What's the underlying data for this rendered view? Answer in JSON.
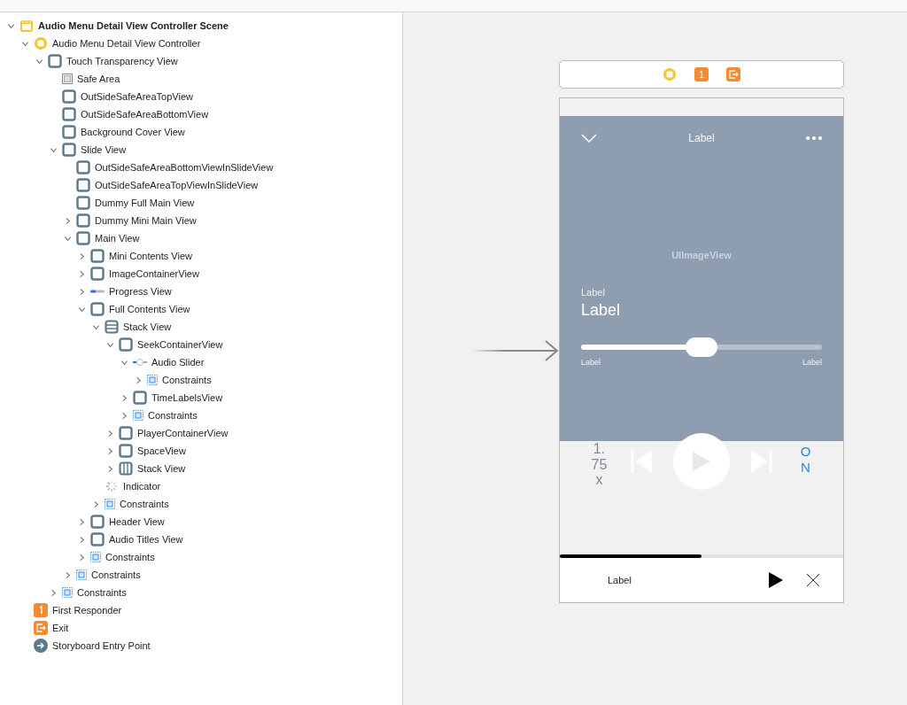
{
  "outline": [
    {
      "label": "Audio Menu Detail View Controller Scene",
      "kind": "scene",
      "expanded": true,
      "children": [
        {
          "label": "Audio Menu Detail View Controller",
          "kind": "controller",
          "expanded": true,
          "children": [
            {
              "label": "Touch Transparency View",
              "kind": "view",
              "expanded": true,
              "children": [
                {
                  "label": "Safe Area",
                  "kind": "safe-area"
                },
                {
                  "label": "OutSideSafeAreaTopView",
                  "kind": "view"
                },
                {
                  "label": "OutSideSafeAreaBottomView",
                  "kind": "view"
                },
                {
                  "label": "Background Cover View",
                  "kind": "view"
                },
                {
                  "label": "Slide View",
                  "kind": "view",
                  "expanded": true,
                  "children": [
                    {
                      "label": "OutSideSafeAreaBottomViewInSlideView",
                      "kind": "view"
                    },
                    {
                      "label": "OutSideSafeAreaTopViewInSlideView",
                      "kind": "view"
                    },
                    {
                      "label": "Dummy Full Main View",
                      "kind": "view"
                    },
                    {
                      "label": "Dummy Mini Main View",
                      "kind": "view",
                      "expanded": false
                    },
                    {
                      "label": "Main View",
                      "kind": "view",
                      "expanded": true,
                      "children": [
                        {
                          "label": "Mini Contents View",
                          "kind": "view",
                          "expanded": false
                        },
                        {
                          "label": "ImageContainerView",
                          "kind": "view",
                          "expanded": false
                        },
                        {
                          "label": "Progress View",
                          "kind": "progress",
                          "expanded": false
                        },
                        {
                          "label": "Full Contents View",
                          "kind": "view",
                          "expanded": true,
                          "children": [
                            {
                              "label": "Stack View",
                              "kind": "vstack",
                              "expanded": true,
                              "children": [
                                {
                                  "label": "SeekContainerView",
                                  "kind": "view",
                                  "expanded": true,
                                  "children": [
                                    {
                                      "label": "Audio Slider",
                                      "kind": "slider",
                                      "expanded": true,
                                      "children": [
                                        {
                                          "label": "Constraints",
                                          "kind": "constraints",
                                          "expanded": false
                                        }
                                      ]
                                    },
                                    {
                                      "label": "TimeLabelsView",
                                      "kind": "view",
                                      "expanded": false
                                    },
                                    {
                                      "label": "Constraints",
                                      "kind": "constraints",
                                      "expanded": false
                                    }
                                  ]
                                },
                                {
                                  "label": "PlayerContainerView",
                                  "kind": "view",
                                  "expanded": false
                                },
                                {
                                  "label": "SpaceView",
                                  "kind": "view",
                                  "expanded": false
                                },
                                {
                                  "label": "Stack View",
                                  "kind": "hstack",
                                  "expanded": false
                                }
                              ]
                            },
                            {
                              "label": "Indicator",
                              "kind": "indicator"
                            },
                            {
                              "label": "Constraints",
                              "kind": "constraints",
                              "expanded": false
                            }
                          ]
                        },
                        {
                          "label": "Header View",
                          "kind": "view",
                          "expanded": false
                        },
                        {
                          "label": "Audio Titles View",
                          "kind": "view",
                          "expanded": false
                        },
                        {
                          "label": "Constraints",
                          "kind": "constraints",
                          "expanded": false
                        }
                      ]
                    },
                    {
                      "label": "Constraints",
                      "kind": "constraints",
                      "expanded": false
                    }
                  ]
                },
                {
                  "label": "Constraints",
                  "kind": "constraints",
                  "expanded": false
                }
              ]
            }
          ]
        },
        {
          "label": "First Responder",
          "kind": "responder"
        },
        {
          "label": "Exit",
          "kind": "exit"
        },
        {
          "label": "Storyboard Entry Point",
          "kind": "entry"
        }
      ]
    }
  ],
  "canvas": {
    "dock": {
      "badge": "1"
    },
    "header": {
      "title": "Label"
    },
    "image_view": {
      "label": "UIImageView"
    },
    "subtitle": "Label",
    "title": "Label",
    "slider": {
      "level": 0.5
    },
    "time_labels": [
      "Label",
      "Label"
    ],
    "speed": "1.75x",
    "toggle": "ON",
    "mini_player": {
      "level": 0.5,
      "label": "Label"
    }
  }
}
